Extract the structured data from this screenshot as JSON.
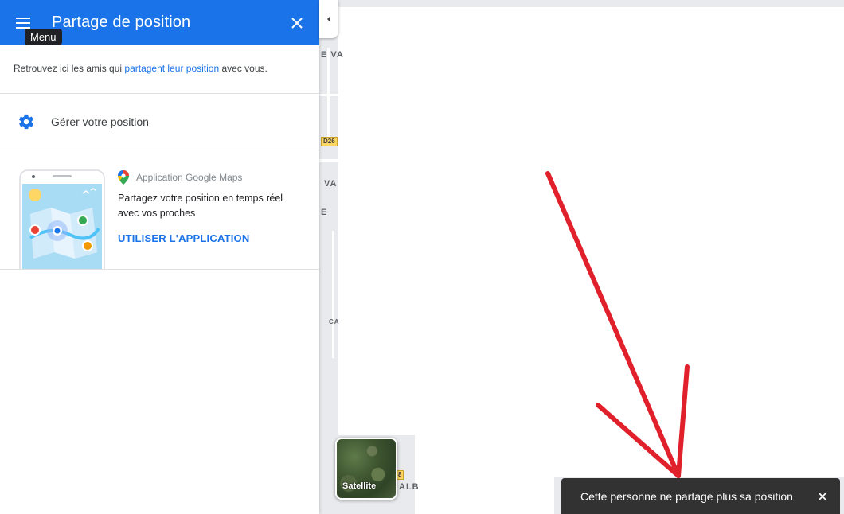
{
  "panel": {
    "title": "Partage de position",
    "menu_tooltip": "Menu",
    "intro_before": "Retrouvez ici les amis qui ",
    "intro_link": "partagent leur position",
    "intro_after": " avec vous.",
    "manage_label": "Gérer votre position",
    "promo": {
      "app_name": "Application Google Maps",
      "description": "Partagez votre position en temps réel avec vos proches",
      "cta": "UTILISER L'APPLICATION"
    }
  },
  "map": {
    "labels": [
      "E VA",
      "VA",
      "E",
      "CA",
      "ALB"
    ],
    "road_shields": [
      "D26",
      "8"
    ],
    "satellite_label": "Satellite"
  },
  "toast": {
    "message": "Cette personne ne partage plus sa position"
  },
  "colors": {
    "header_blue": "#1a73e8",
    "link_blue": "#1a73e8",
    "toast_bg": "#323232",
    "annotation_red": "#e0202a"
  },
  "icons": {
    "menu": "hamburger-menu-icon",
    "close": "close-icon",
    "settings": "gear-icon",
    "maps_pin": "google-maps-pin-icon",
    "collapse": "chevron-left-icon",
    "toast_close": "close-icon"
  }
}
